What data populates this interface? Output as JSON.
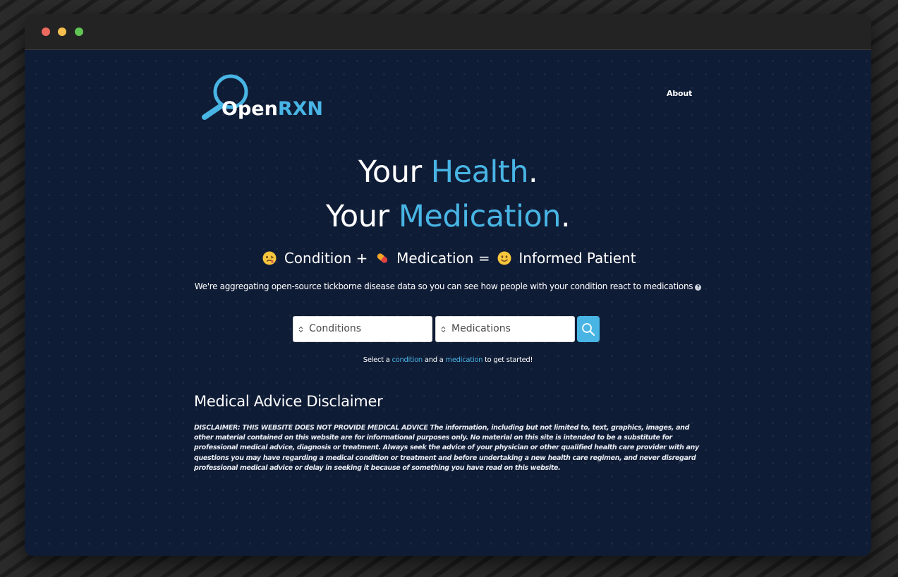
{
  "app": {
    "logo_text_white": "Open",
    "logo_text_accent": "RXN"
  },
  "nav": {
    "about": "About"
  },
  "hero": {
    "line1_plain": "Your ",
    "line1_accent": "Health",
    "line1_end": ".",
    "line2_plain": "Your ",
    "line2_accent": "Medication",
    "line2_end": "."
  },
  "equation": {
    "part1": "Condition",
    "plus": "+",
    "part2": "Medication",
    "equals": "=",
    "part3": "Informed Patient",
    "icons": [
      "sick-face-emoji",
      "pill-emoji",
      "smiling-face-emoji"
    ]
  },
  "tagline": {
    "text": "We're aggregating open-source tickborne disease data so you can see how people with your condition react to medications",
    "info_icon": "?"
  },
  "search": {
    "conditions_placeholder": "Conditions",
    "medications_placeholder": "Medications",
    "button_icon": "search-icon"
  },
  "hint": {
    "prefix": "Select a ",
    "link1": "condition",
    "middle": " and a ",
    "link2": "medication",
    "suffix": " to get started!"
  },
  "disclaimer": {
    "heading": "Medical Advice Disclaimer",
    "body": "DISCLAIMER: THIS WEBSITE DOES NOT PROVIDE MEDICAL ADVICE The information, including but not limited to, text, graphics, images, and other material contained on this website are for informational purposes only. No material on this site is intended to be a substitute for professional medical advice, diagnosis or treatment. Always seek the advice of your physician or other qualified health care provider with any questions you may have regarding a medical condition or treatment and before undertaking a new health care regimen, and never disregard professional medical advice or delay in seeking it because of something you have read on this website."
  },
  "colors": {
    "accent": "#48b5e4",
    "background": "#0f1c36",
    "text": "#ffffff"
  }
}
